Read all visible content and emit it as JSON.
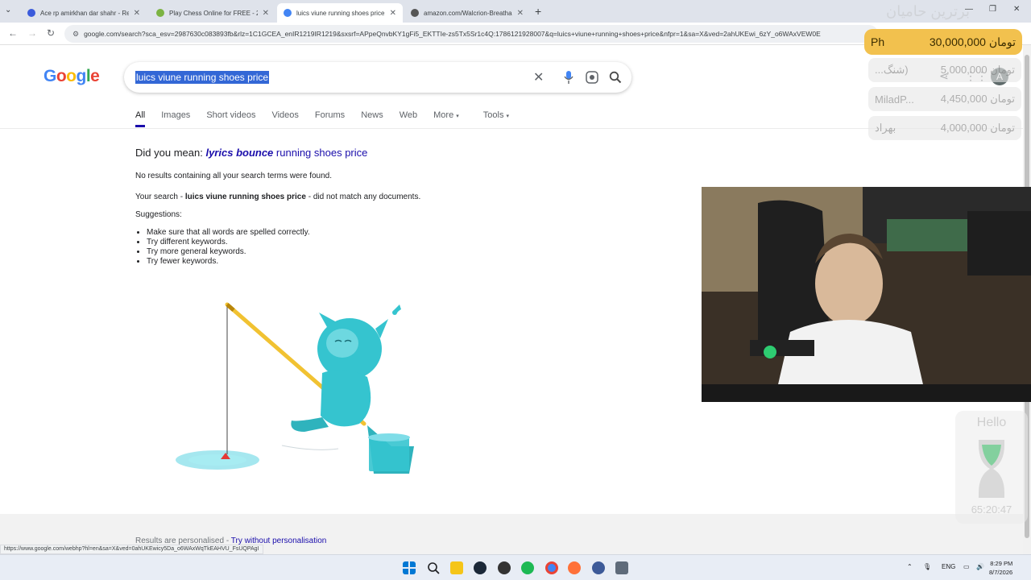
{
  "browser": {
    "tabs": [
      {
        "title": "Ace rp amirkhan dar shahr - Re",
        "active": false
      },
      {
        "title": "Play Chess Online for FREE - 2",
        "active": false
      },
      {
        "title": "luics viune running shoes price",
        "active": true
      },
      {
        "title": "amazon.com/Walcrion-Breatha",
        "active": false
      }
    ],
    "url": "google.com/search?sca_esv=2987630c083893fb&rlz=1C1GCEA_enIR1219IR1219&sxsrf=APpeQnvbKY1gFi5_EKTTIe-zs5Tx5Sr1c4Q:1786121928007&q=luics+viune+running+shoes+price&nfpr=1&sa=X&ved=2ahUKEwi_6zY_o6WAxVEW0E"
  },
  "google": {
    "logo": "Google",
    "query": "luics viune running shoes price",
    "nav_tabs": [
      "All",
      "Images",
      "Short videos",
      "Videos",
      "Forums",
      "News",
      "Web",
      "More",
      "Tools"
    ],
    "did_you_mean_prefix": "Did you mean:",
    "suggestion_bold_1": "lyrics",
    "suggestion_bold_2": "bounce",
    "suggestion_rest": "running shoes price",
    "no_results": "No results containing all your search terms were found.",
    "your_search_prefix": "Your search -",
    "your_search_term": "luics viune running shoes price",
    "your_search_suffix": "- did not match any documents.",
    "suggestions_label": "Suggestions:",
    "tips": [
      "Make sure that all words are spelled correctly.",
      "Try different keywords.",
      "Try more general keywords.",
      "Try fewer keywords."
    ],
    "footer_personalised": "Results are personalised -",
    "footer_link": "Try without personalisation",
    "status_url": "https://www.google.com/webhp?hl=en&sa=X&ved=0ahUKEwicy5Da_o6WAxWqTkEAHVU_FsUQPAgI",
    "avatar_letter": "A"
  },
  "overlay": {
    "header": "برترین حامیان",
    "top_name": "Ph",
    "top_amount": "30,000,000 تومان",
    "rows": [
      {
        "name": "...شنگ)",
        "amount": "5,000,000 تومان"
      },
      {
        "name": "MiladP...",
        "amount": "4,450,000 تومان"
      },
      {
        "name": "بهراد",
        "amount": "4,000,000 تومان"
      }
    ],
    "timer_label": "Hello",
    "timer_time": "65:20:47"
  },
  "taskbar": {
    "lang": "ENG",
    "time": "8:29 PM",
    "date": "8/7/2026"
  },
  "colors": {
    "link": "#1a0dab",
    "selection": "#3367d6",
    "gold": "#f2c14e"
  }
}
